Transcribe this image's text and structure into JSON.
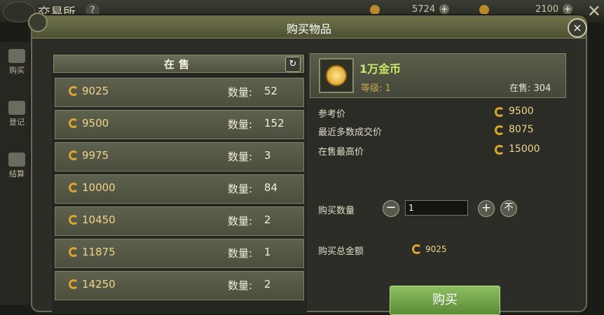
{
  "background": {
    "title": "交易所",
    "help": "?",
    "currency_1": "5724",
    "currency_2": "2100",
    "sidebar": [
      {
        "label": "购买"
      },
      {
        "label": "登记"
      },
      {
        "label": "结算"
      }
    ]
  },
  "modal": {
    "title": "购买物品",
    "close": "×"
  },
  "list": {
    "header": "在售",
    "refresh": "↻",
    "qty_label": "数量:",
    "rows": [
      {
        "price": "9025",
        "qty": "52"
      },
      {
        "price": "9500",
        "qty": "152"
      },
      {
        "price": "9975",
        "qty": "3"
      },
      {
        "price": "10000",
        "qty": "84"
      },
      {
        "price": "10450",
        "qty": "2"
      },
      {
        "price": "11875",
        "qty": "1"
      },
      {
        "price": "14250",
        "qty": "2"
      }
    ]
  },
  "item": {
    "name": "1万金币",
    "level": "等级: 1",
    "stock": "在售: 304"
  },
  "info": {
    "ref_label": "参考价",
    "ref_value": "9500",
    "recent_label": "最近多数成交价",
    "recent_value": "8075",
    "max_label": "在售最高价",
    "max_value": "15000"
  },
  "buy": {
    "qty_label": "购买数量",
    "minus": "−",
    "qty_value": "1",
    "plus": "+",
    "max": "不",
    "total_label": "购买总金额",
    "total_value": "9025",
    "button": "购买"
  }
}
